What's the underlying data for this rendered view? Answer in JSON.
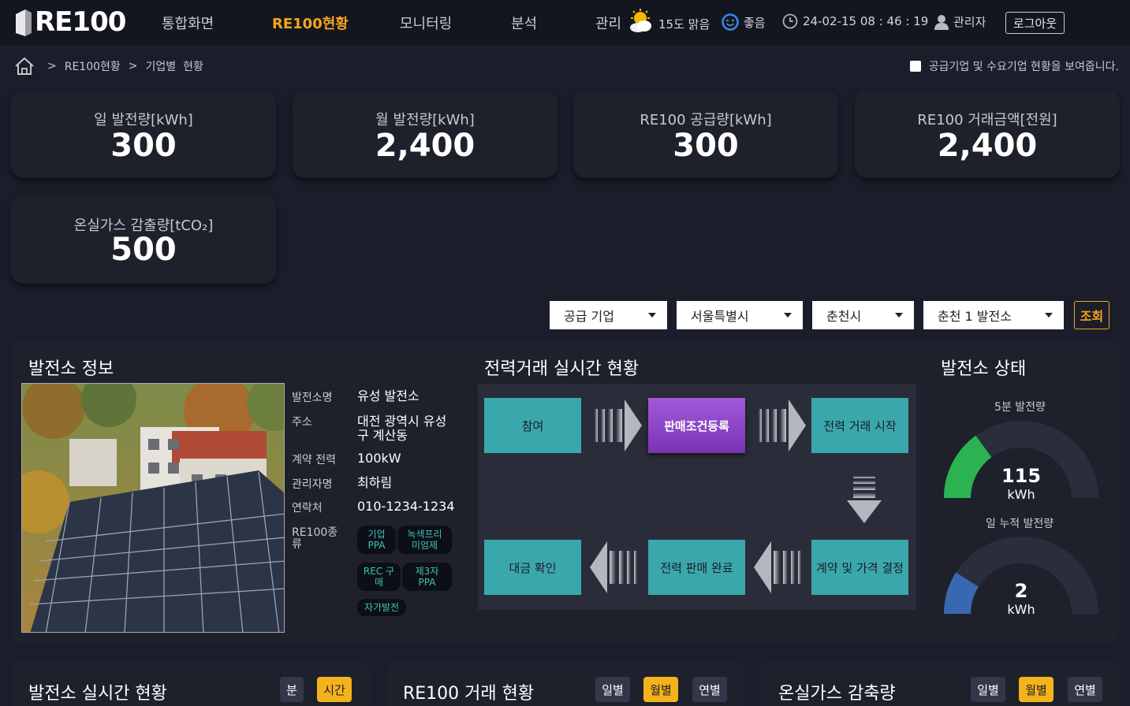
{
  "header": {
    "logo": "RE100",
    "nav": [
      "통합화면",
      "RE100현황",
      "모니터링",
      "분석",
      "관리"
    ],
    "weather": "15도 맑음",
    "air": "좋음",
    "datetime": "24-02-15 08 : 46 : 19",
    "user": "관리자",
    "logout": "로그아웃"
  },
  "breadcrumb": {
    "sep": ">",
    "level1": "RE100현황",
    "level2": "기업별  현황"
  },
  "notice": "공급기업 및 수요기업 현황을 보여줍니다.",
  "stats": [
    {
      "label": "일 발전량[kWh]",
      "value": "300"
    },
    {
      "label": "월 발전량[kWh]",
      "value": "2,400"
    },
    {
      "label": "RE100 공급량[kWh]",
      "value": "300"
    },
    {
      "label": "RE100 거래금액[전원]",
      "value": "2,400"
    },
    {
      "label": "온실가스 감출량[tCO₂]",
      "value": "500"
    }
  ],
  "filters": {
    "company": "공급 기업",
    "region": "서울특별시",
    "city": "춘천시",
    "plant": "춘천 1 발전소",
    "search": "조회"
  },
  "plant_info": {
    "title": "발전소 정보",
    "name_label": "발전소명",
    "name": "유성 발전소",
    "addr_label": "주소",
    "addr1": "대전 광역시 유성",
    "addr2": "구 계산동",
    "cap_label": "계약 전력",
    "cap": "100kW",
    "mgr_label": "관리자명",
    "mgr": "최하림",
    "tel_label": "연락처",
    "tel": "010-1234-1234",
    "type_label1": "RE100종",
    "type_label2": "류",
    "tags": [
      {
        "l1": "기업",
        "l2": "PPA"
      },
      {
        "l1": "녹색프리",
        "l2": "미엄제"
      },
      {
        "l1": "REC 구",
        "l2": "매"
      },
      {
        "l1": "제3자",
        "l2": "PPA"
      },
      {
        "l1": "자가발전",
        "l2": ""
      }
    ]
  },
  "trade_flow": {
    "title": "전력거래 실시간 현황",
    "steps": [
      "참여",
      "판매조건등록",
      "전력 거래 시작",
      "계약 및 가격 결정",
      "전력 판매 완료",
      "대금 확인"
    ]
  },
  "plant_status": {
    "title": "발전소 상태",
    "g1_label": "5분 발전량",
    "g1_value": "115",
    "g1_unit": "kWh",
    "g1_ratio": 0.3,
    "g2_label": "일 누적 발전량",
    "g2_value": "2",
    "g2_unit": "kWh",
    "g2_ratio": 0.18,
    "colors": {
      "g1": "#2bb351",
      "g2": "#3a68b0",
      "track": "#2a2d3a"
    }
  },
  "bottom": [
    {
      "title": "발전소 실시간 현황",
      "tabs": [
        "분",
        "시간"
      ],
      "active": 1
    },
    {
      "title": "RE100 거래 현황",
      "tabs": [
        "일별",
        "월별",
        "연별"
      ],
      "active": 1
    },
    {
      "title": "온실가스 감축량",
      "tabs": [
        "일별",
        "월별",
        "연별"
      ],
      "active": 1
    }
  ],
  "accent": "#f4a51c"
}
